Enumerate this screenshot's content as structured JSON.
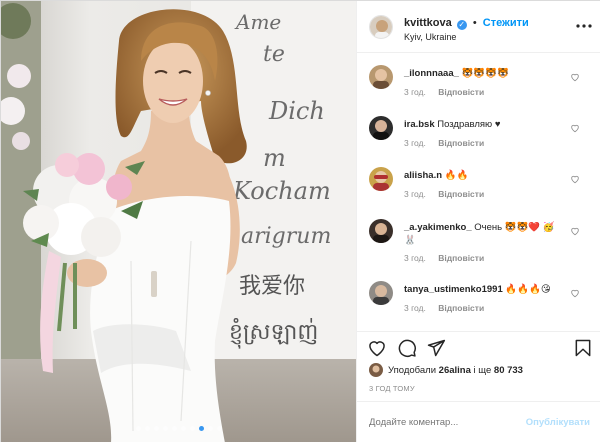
{
  "post": {
    "username": "kvittkova",
    "follow_label": "Стежити",
    "separator": "•",
    "location": "Kyiv, Ukraine",
    "more_icon": "more-dots-icon",
    "photo_text": {
      "lines": [
        "Ame",
        "te",
        "Dich",
        "m",
        "Kocham",
        "arigrum"
      ],
      "chinese": "我爱你",
      "khmer": "ខ្ញុំស្រឡាញ់"
    },
    "carousel": {
      "count": 10,
      "active_index": 7
    }
  },
  "comments": [
    {
      "username": "_ilonnnaaa_",
      "text": "🐯🐯🐯🐯",
      "time": "3 год.",
      "reply": "Відповісти"
    },
    {
      "username": "ira.bsk",
      "text": "Поздравляю ♥",
      "time": "3 год.",
      "reply": "Відповісти"
    },
    {
      "username": "aliisha.n",
      "text": "🔥🔥",
      "time": "3 год.",
      "reply": "Відповісти"
    },
    {
      "username": "_a.yakimenko_",
      "text": "Очень 🐯🐯❤️ 🥳🐰",
      "time": "3 год.",
      "reply": "Відповісти"
    },
    {
      "username": "tanya_ustimenko1991",
      "text": "🔥🔥🔥😘",
      "time": "3 год.",
      "reply": "Відповісти"
    }
  ],
  "actions": {
    "like_icon": "heart-icon",
    "comment_icon": "comment-icon",
    "share_icon": "share-icon",
    "save_icon": "bookmark-icon"
  },
  "likes": {
    "prefix": "Уподобали",
    "user": "26alina",
    "middle": "і ще",
    "count": "80 733"
  },
  "time_ago": "3 ГОД ТОМУ",
  "add_comment": {
    "placeholder": "Додайте коментар...",
    "post_label": "Опублікувати"
  },
  "colors": {
    "accent": "#0095f6",
    "verified": "#3897f0",
    "post_disabled": "#b2dffc",
    "muted": "#8e8e8e"
  }
}
